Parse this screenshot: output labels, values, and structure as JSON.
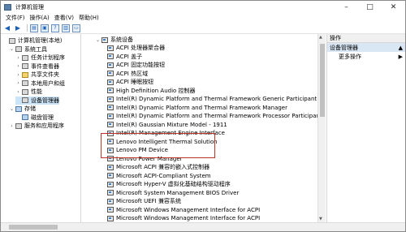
{
  "window": {
    "title": "计算机管理"
  },
  "menu": [
    "文件(F)",
    "操作(A)",
    "查看(V)",
    "帮助(H)"
  ],
  "tree": [
    {
      "label": "计算机管理(本地)",
      "indent": 0,
      "toggle": "",
      "icon": "computer-icon"
    },
    {
      "label": "系统工具",
      "indent": 1,
      "toggle": "⌄",
      "icon": "tools-icon"
    },
    {
      "label": "任务计划程序",
      "indent": 2,
      "toggle": "›",
      "icon": "task-scheduler-icon"
    },
    {
      "label": "事件查看器",
      "indent": 2,
      "toggle": "›",
      "icon": "event-viewer-icon"
    },
    {
      "label": "共享文件夹",
      "indent": 2,
      "toggle": "›",
      "icon": "shared-folders-icon"
    },
    {
      "label": "本地用户和组",
      "indent": 2,
      "toggle": "›",
      "icon": "users-groups-icon"
    },
    {
      "label": "性能",
      "indent": 2,
      "toggle": "›",
      "icon": "performance-icon"
    },
    {
      "label": "设备管理器",
      "indent": 2,
      "toggle": "",
      "icon": "device-manager-icon",
      "selected": true
    },
    {
      "label": "存储",
      "indent": 1,
      "toggle": "⌄",
      "icon": "storage-icon"
    },
    {
      "label": "磁盘管理",
      "indent": 2,
      "toggle": "",
      "icon": "disk-management-icon"
    },
    {
      "label": "服务和应用程序",
      "indent": 1,
      "toggle": "›",
      "icon": "services-apps-icon"
    }
  ],
  "devices": {
    "category": "系统设备",
    "items": [
      "ACPI 处理器聚合器",
      "ACPI 盖子",
      "ACPI 固定功能按钮",
      "ACPI 热区域",
      "ACPI 睡眠按钮",
      "High Definition Audio 控制器",
      "Intel(R) Dynamic Platform and Thermal Framework Generic Participant",
      "Intel(R) Dynamic Platform and Thermal Framework Manager",
      "Intel(R) Dynamic Platform and Thermal Framework Processor Participant",
      "Intel(R) Gaussian Mixture Model - 1911",
      "Intel(R) Management Engine Interface",
      "Lenovo Intelligent Thermal Solution",
      "Lenovo PM Device",
      "Lenovo Power Manager",
      "Microsoft ACPI 兼容的嵌入式控制器",
      "Microsoft ACPI-Compliant System",
      "Microsoft Hyper-V 虚拟化基础结构驱动程序",
      "Microsoft System Management BIOS Driver",
      "Microsoft UEFI 兼容系统",
      "Microsoft Windows Management Interface for ACPI",
      "Microsoft Windows Management Interface for ACPI",
      "Microsoft Windows Management Interface for ACPI",
      "Microsoft Windows Management Interface for ACPI"
    ]
  },
  "actions": {
    "header": "操作",
    "section": "设备管理器",
    "more": "更多操作"
  }
}
